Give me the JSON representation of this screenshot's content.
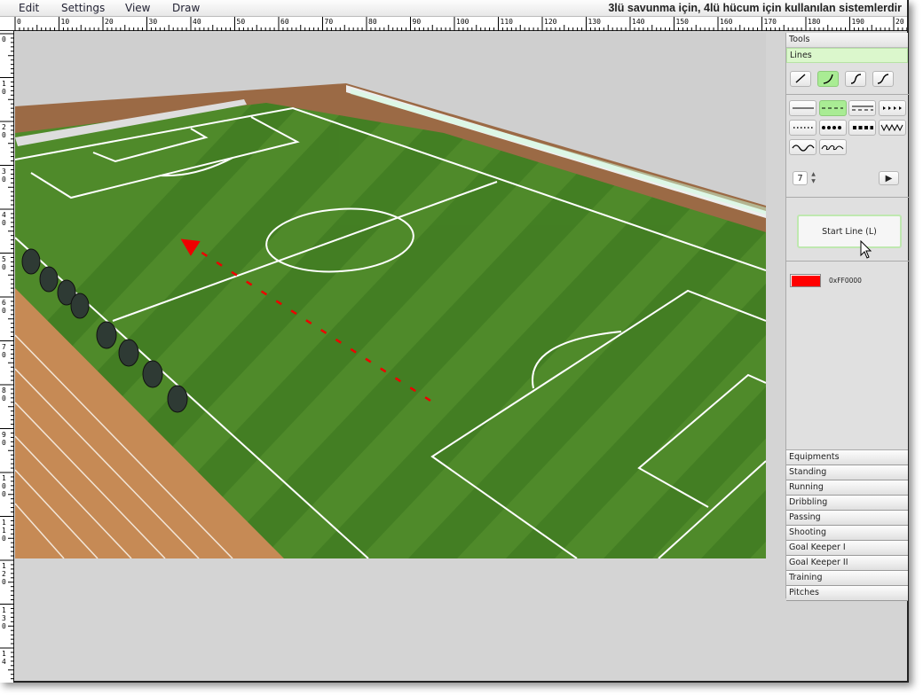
{
  "menu": [
    "Edit",
    "Settings",
    "View",
    "Draw"
  ],
  "title": "3lü savunma için, 4lü hücum için kullanılan sistemlerdir",
  "ruler": {
    "h_labels": [
      "0",
      "10",
      "20",
      "30",
      "40",
      "50",
      "60",
      "70",
      "80",
      "90",
      "100",
      "110",
      "120",
      "130",
      "140",
      "150",
      "160",
      "170",
      "180",
      "190",
      "20"
    ],
    "v_labels": [
      "0",
      "10",
      "20",
      "30",
      "40",
      "50",
      "60",
      "70",
      "80",
      "90",
      "100",
      "110",
      "120",
      "130",
      "14"
    ]
  },
  "panel": {
    "tools_header": "Tools",
    "lines_header": "Lines",
    "line_shapes": [
      "straight-line-icon",
      "curve-line-icon",
      "s-curve-line-icon",
      "s-wave-line-icon"
    ],
    "selected_shape": 1,
    "line_styles": [
      "solid",
      "dashed",
      "double-dashed",
      "arrows",
      "dotted",
      "big-dots",
      "squares",
      "zigzag",
      "wave",
      "loop-wave"
    ],
    "selected_style": 1,
    "thickness": "7",
    "start_line": "Start Line (L)",
    "color": "#FF0000",
    "color_label": "0xFF0000",
    "categories": [
      "Equipments",
      "Standing",
      "Running",
      "Dribbling",
      "Passing",
      "Shooting",
      "Goal Keeper I",
      "Goal Keeper II",
      "Training",
      "Pitches"
    ]
  },
  "drawing": {
    "line_color": "#FF0000",
    "style": "dashed",
    "arrow": "start"
  }
}
